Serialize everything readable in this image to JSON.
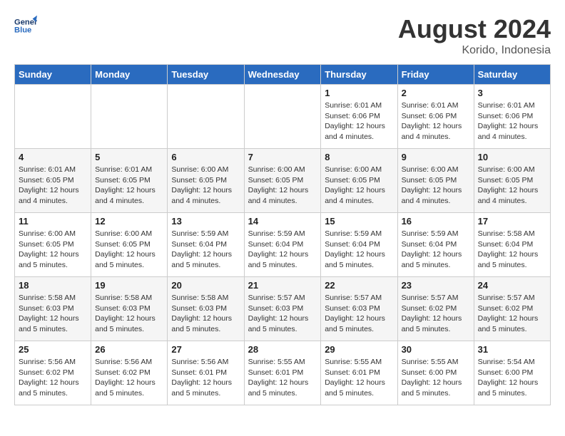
{
  "header": {
    "logo_line1": "General",
    "logo_line2": "Blue",
    "month_year": "August 2024",
    "location": "Korido, Indonesia"
  },
  "weekdays": [
    "Sunday",
    "Monday",
    "Tuesday",
    "Wednesday",
    "Thursday",
    "Friday",
    "Saturday"
  ],
  "weeks": [
    [
      {
        "day": "",
        "info": ""
      },
      {
        "day": "",
        "info": ""
      },
      {
        "day": "",
        "info": ""
      },
      {
        "day": "",
        "info": ""
      },
      {
        "day": "1",
        "info": "Sunrise: 6:01 AM\nSunset: 6:06 PM\nDaylight: 12 hours\nand 4 minutes."
      },
      {
        "day": "2",
        "info": "Sunrise: 6:01 AM\nSunset: 6:06 PM\nDaylight: 12 hours\nand 4 minutes."
      },
      {
        "day": "3",
        "info": "Sunrise: 6:01 AM\nSunset: 6:06 PM\nDaylight: 12 hours\nand 4 minutes."
      }
    ],
    [
      {
        "day": "4",
        "info": "Sunrise: 6:01 AM\nSunset: 6:05 PM\nDaylight: 12 hours\nand 4 minutes."
      },
      {
        "day": "5",
        "info": "Sunrise: 6:01 AM\nSunset: 6:05 PM\nDaylight: 12 hours\nand 4 minutes."
      },
      {
        "day": "6",
        "info": "Sunrise: 6:00 AM\nSunset: 6:05 PM\nDaylight: 12 hours\nand 4 minutes."
      },
      {
        "day": "7",
        "info": "Sunrise: 6:00 AM\nSunset: 6:05 PM\nDaylight: 12 hours\nand 4 minutes."
      },
      {
        "day": "8",
        "info": "Sunrise: 6:00 AM\nSunset: 6:05 PM\nDaylight: 12 hours\nand 4 minutes."
      },
      {
        "day": "9",
        "info": "Sunrise: 6:00 AM\nSunset: 6:05 PM\nDaylight: 12 hours\nand 4 minutes."
      },
      {
        "day": "10",
        "info": "Sunrise: 6:00 AM\nSunset: 6:05 PM\nDaylight: 12 hours\nand 4 minutes."
      }
    ],
    [
      {
        "day": "11",
        "info": "Sunrise: 6:00 AM\nSunset: 6:05 PM\nDaylight: 12 hours\nand 5 minutes."
      },
      {
        "day": "12",
        "info": "Sunrise: 6:00 AM\nSunset: 6:05 PM\nDaylight: 12 hours\nand 5 minutes."
      },
      {
        "day": "13",
        "info": "Sunrise: 5:59 AM\nSunset: 6:04 PM\nDaylight: 12 hours\nand 5 minutes."
      },
      {
        "day": "14",
        "info": "Sunrise: 5:59 AM\nSunset: 6:04 PM\nDaylight: 12 hours\nand 5 minutes."
      },
      {
        "day": "15",
        "info": "Sunrise: 5:59 AM\nSunset: 6:04 PM\nDaylight: 12 hours\nand 5 minutes."
      },
      {
        "day": "16",
        "info": "Sunrise: 5:59 AM\nSunset: 6:04 PM\nDaylight: 12 hours\nand 5 minutes."
      },
      {
        "day": "17",
        "info": "Sunrise: 5:58 AM\nSunset: 6:04 PM\nDaylight: 12 hours\nand 5 minutes."
      }
    ],
    [
      {
        "day": "18",
        "info": "Sunrise: 5:58 AM\nSunset: 6:03 PM\nDaylight: 12 hours\nand 5 minutes."
      },
      {
        "day": "19",
        "info": "Sunrise: 5:58 AM\nSunset: 6:03 PM\nDaylight: 12 hours\nand 5 minutes."
      },
      {
        "day": "20",
        "info": "Sunrise: 5:58 AM\nSunset: 6:03 PM\nDaylight: 12 hours\nand 5 minutes."
      },
      {
        "day": "21",
        "info": "Sunrise: 5:57 AM\nSunset: 6:03 PM\nDaylight: 12 hours\nand 5 minutes."
      },
      {
        "day": "22",
        "info": "Sunrise: 5:57 AM\nSunset: 6:03 PM\nDaylight: 12 hours\nand 5 minutes."
      },
      {
        "day": "23",
        "info": "Sunrise: 5:57 AM\nSunset: 6:02 PM\nDaylight: 12 hours\nand 5 minutes."
      },
      {
        "day": "24",
        "info": "Sunrise: 5:57 AM\nSunset: 6:02 PM\nDaylight: 12 hours\nand 5 minutes."
      }
    ],
    [
      {
        "day": "25",
        "info": "Sunrise: 5:56 AM\nSunset: 6:02 PM\nDaylight: 12 hours\nand 5 minutes."
      },
      {
        "day": "26",
        "info": "Sunrise: 5:56 AM\nSunset: 6:02 PM\nDaylight: 12 hours\nand 5 minutes."
      },
      {
        "day": "27",
        "info": "Sunrise: 5:56 AM\nSunset: 6:01 PM\nDaylight: 12 hours\nand 5 minutes."
      },
      {
        "day": "28",
        "info": "Sunrise: 5:55 AM\nSunset: 6:01 PM\nDaylight: 12 hours\nand 5 minutes."
      },
      {
        "day": "29",
        "info": "Sunrise: 5:55 AM\nSunset: 6:01 PM\nDaylight: 12 hours\nand 5 minutes."
      },
      {
        "day": "30",
        "info": "Sunrise: 5:55 AM\nSunset: 6:00 PM\nDaylight: 12 hours\nand 5 minutes."
      },
      {
        "day": "31",
        "info": "Sunrise: 5:54 AM\nSunset: 6:00 PM\nDaylight: 12 hours\nand 5 minutes."
      }
    ]
  ]
}
